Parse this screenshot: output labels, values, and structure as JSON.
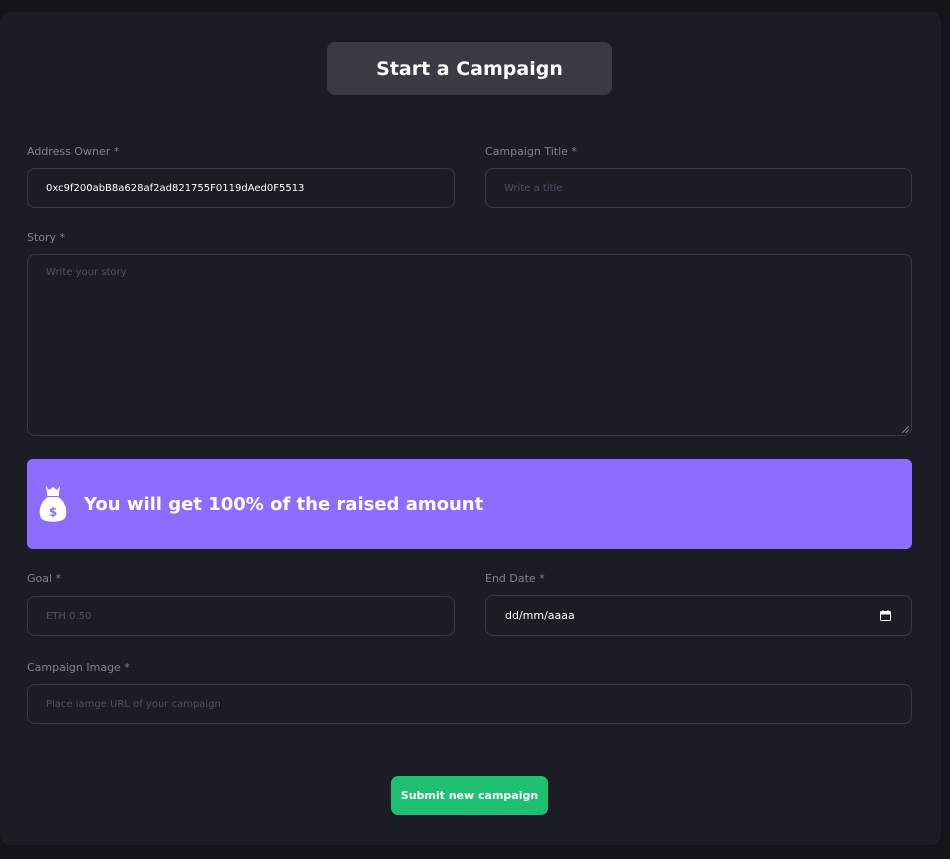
{
  "page": {
    "title": "Start a Campaign"
  },
  "form": {
    "address_owner": {
      "label": "Address Owner *",
      "value": "0xc9f200abB8a628af2ad821755F0119dAed0F5513"
    },
    "campaign_title": {
      "label": "Campaign Title *",
      "placeholder": "Write a title",
      "value": ""
    },
    "story": {
      "label": "Story *",
      "placeholder": "Write your story",
      "value": ""
    },
    "goal": {
      "label": "Goal *",
      "placeholder": "ETH 0.50",
      "value": ""
    },
    "end_date": {
      "label": "End Date *",
      "value": "dd/mm/aaaa"
    },
    "campaign_image": {
      "label": "Campaign Image *",
      "placeholder": "Place iamge URL of your campaign",
      "value": ""
    },
    "submit_label": "Submit new campaign"
  },
  "banner": {
    "text": "You will get 100% of the raised amount",
    "icon": "money-bag-icon"
  },
  "colors": {
    "background": "#13131a",
    "panel": "#1c1c24",
    "title_box": "#3a3a43",
    "banner": "#8c6dfd",
    "submit": "#1dc071",
    "label": "#808191",
    "border": "#3a3a43"
  }
}
